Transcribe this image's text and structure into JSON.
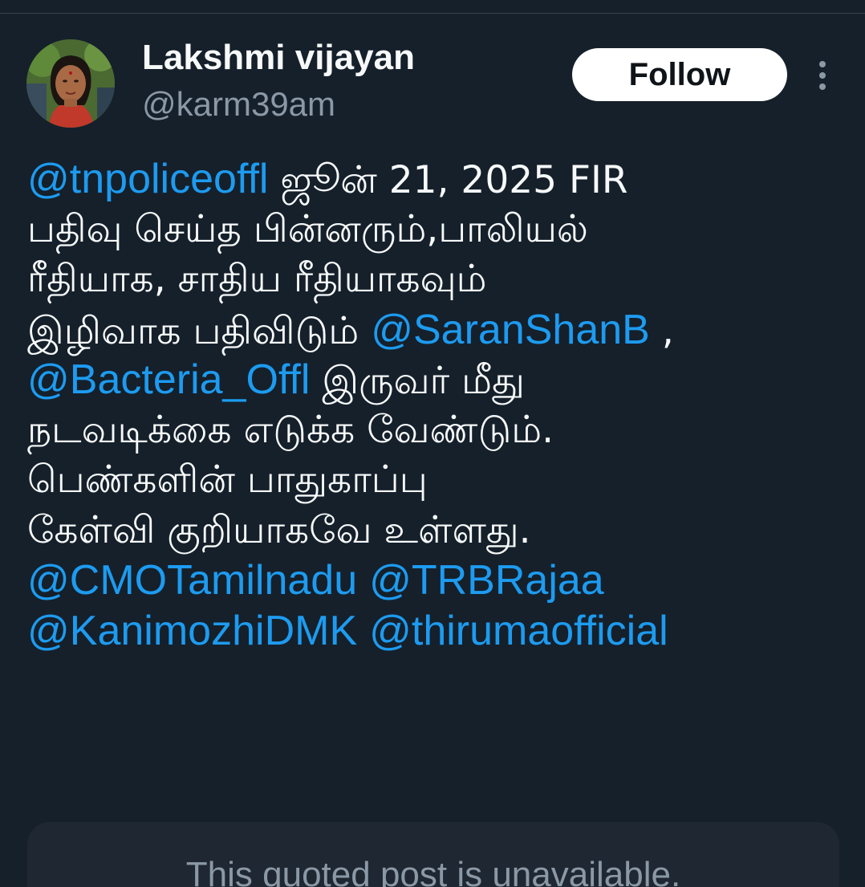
{
  "author": {
    "display_name": "Lakshmi vijayan",
    "handle": "@karm39am",
    "avatar_icon": "profile-photo"
  },
  "actions": {
    "follow_label": "Follow",
    "more_icon": "more-vertical-icon"
  },
  "tweet": {
    "lines": [
      [
        {
          "text": "@tnpoliceoffl",
          "mention": true
        },
        {
          "text": "  ஜூன் 21, 2025 FIR",
          "mention": false
        }
      ],
      [
        {
          "text": "பதிவு செய்த  பின்னரும்,பாலியல்",
          "mention": false
        }
      ],
      [
        {
          "text": "ரீதியாக, சாதிய ரீதியாகவும்",
          "mention": false
        }
      ],
      [
        {
          "text": "இழிவாக பதிவிடும் ",
          "mention": false
        },
        {
          "text": "@SaranShanB",
          "mention": true
        },
        {
          "text": " ,",
          "mention": false
        }
      ],
      [
        {
          "text": "@Bacteria_Offl",
          "mention": true
        },
        {
          "text": " இருவர் மீது",
          "mention": false
        }
      ],
      [
        {
          "text": "நடவடிக்கை எடுக்க வேண்டும்.",
          "mention": false
        }
      ],
      [
        {
          "text": "பெண்களின் பாதுகாப்பு",
          "mention": false
        }
      ],
      [
        {
          "text": "கேள்வி குறியாகவே உள்ளது.",
          "mention": false
        }
      ],
      [
        {
          "text": "@CMOTamilnadu",
          "mention": true
        },
        {
          "text": " ",
          "mention": false
        },
        {
          "text": "@TRBRajaa",
          "mention": true
        }
      ],
      [
        {
          "text": "@KanimozhiDMK",
          "mention": true
        },
        {
          "text": "  ",
          "mention": false
        },
        {
          "text": "@thirumaofficial",
          "mention": true
        }
      ]
    ]
  },
  "quote": {
    "unavailable_text": "This quoted post is unavailable."
  },
  "colors": {
    "background": "#15202b",
    "mention": "#1d9bf0",
    "text": "#f7f9f9",
    "secondary_text": "#8b98a5",
    "quote_box": "#1e2732"
  }
}
